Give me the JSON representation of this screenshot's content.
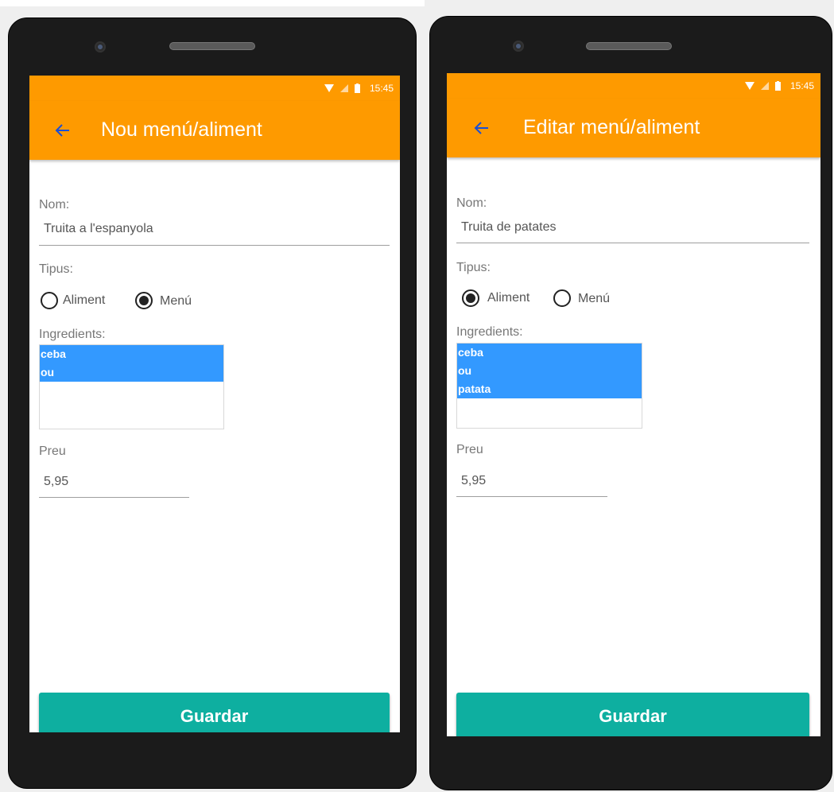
{
  "colors": {
    "accent": "#fe9a00",
    "button": "#0eafa0",
    "selection": "#3399ff"
  },
  "screens": [
    {
      "status": {
        "time": "15:45"
      },
      "title": "Nou menú/aliment",
      "name_label": "Nom:",
      "name_value": "Truita a l'espanyola",
      "type_label": "Tipus:",
      "type_options": [
        {
          "label": "Aliment",
          "checked": false
        },
        {
          "label": "Menú",
          "checked": true
        }
      ],
      "ingredients_label": "Ingredients:",
      "ingredients": [
        "ceba",
        "ou"
      ],
      "price_label": "Preu",
      "price_value": "5,95",
      "save_label": "Guardar"
    },
    {
      "status": {
        "time": "15:45"
      },
      "title": "Editar menú/aliment",
      "name_label": "Nom:",
      "name_value": "Truita de patates",
      "type_label": "Tipus:",
      "type_options": [
        {
          "label": "Aliment",
          "checked": true
        },
        {
          "label": "Menú",
          "checked": false
        }
      ],
      "ingredients_label": "Ingredients:",
      "ingredients": [
        "ceba",
        "ou",
        "patata"
      ],
      "price_label": "Preu",
      "price_value": "5,95",
      "save_label": "Guardar"
    }
  ]
}
